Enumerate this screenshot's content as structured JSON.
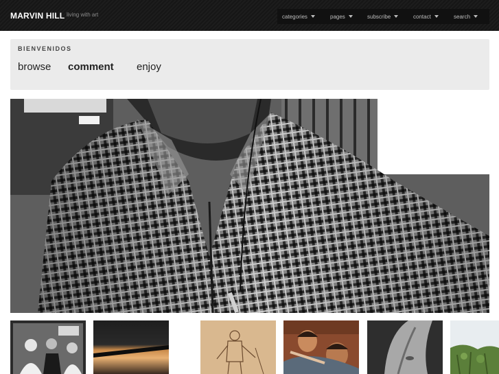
{
  "header": {
    "brand": "MARVIN HILL",
    "tagline": "living with art",
    "nav": [
      {
        "label": "categories"
      },
      {
        "label": "pages"
      },
      {
        "label": "subscribe"
      },
      {
        "label": "contact"
      },
      {
        "label": "search"
      }
    ]
  },
  "welcome": {
    "title": "BIENVENIDOS",
    "links": [
      "browse",
      "comment",
      "enjoy"
    ]
  },
  "colors": {
    "topbar": "#1a1a1a",
    "welcome_bg": "#ebebeb"
  }
}
